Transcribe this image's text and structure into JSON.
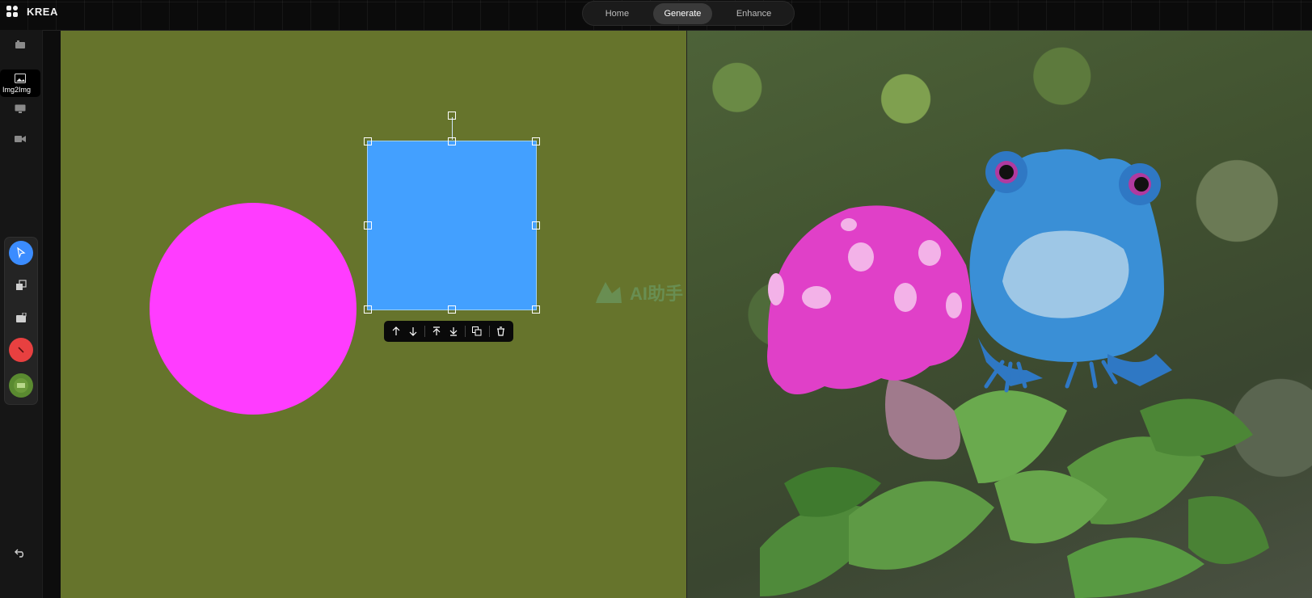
{
  "app": {
    "brand": "KREA"
  },
  "nav": {
    "tabs": [
      {
        "label": "Home",
        "active": false
      },
      {
        "label": "Generate",
        "active": true
      },
      {
        "label": "Enhance",
        "active": false
      }
    ]
  },
  "sidebar": {
    "items": [
      {
        "icon": "film-icon",
        "label": ""
      },
      {
        "icon": "image-icon",
        "label": "Img2Img",
        "active": true
      },
      {
        "icon": "monitor-icon",
        "label": ""
      },
      {
        "icon": "video-camera-icon",
        "label": ""
      }
    ],
    "tools": [
      {
        "icon": "pointer-icon",
        "active": true,
        "color": "#3b8cff"
      },
      {
        "icon": "layers-icon",
        "active": false
      },
      {
        "icon": "image-add-icon",
        "active": false
      },
      {
        "icon": "color-picker-icon",
        "active": false,
        "color": "#e84040"
      },
      {
        "icon": "image-thumbnail-icon",
        "active": false,
        "color": "#5a8a30"
      }
    ],
    "bottom_icon": "undo-icon"
  },
  "canvas": {
    "background": "#66742c",
    "shapes": [
      {
        "type": "circle",
        "color": "#ff3cff"
      },
      {
        "type": "square",
        "color": "#43a0ff",
        "selected": true
      }
    ],
    "floating_toolbar": [
      "move-forward-icon",
      "move-backward-icon",
      "bring-to-front-icon",
      "send-to-back-icon",
      "duplicate-icon",
      "delete-icon"
    ]
  },
  "watermark": {
    "text": "AI助手"
  },
  "output": {
    "description_icon": "generated-image"
  }
}
